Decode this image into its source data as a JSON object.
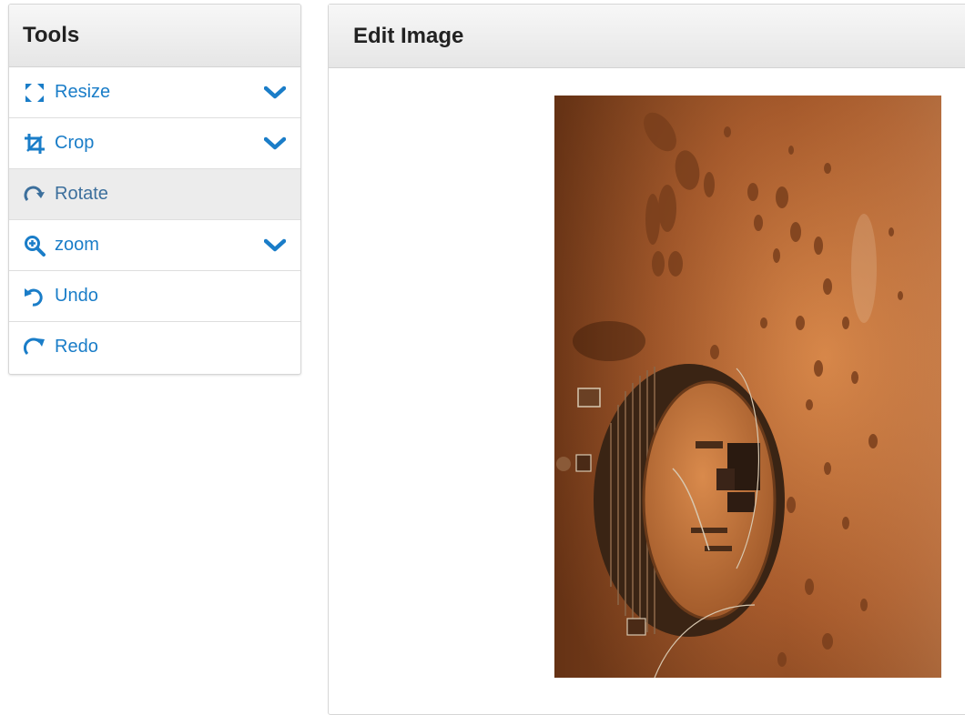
{
  "tools": {
    "title": "Tools",
    "items": [
      {
        "label": "Resize",
        "icon": "expand-icon"
      },
      {
        "label": "Crop",
        "icon": "crop-icon"
      },
      {
        "label": "Rotate",
        "icon": "rotate-icon"
      },
      {
        "label": "zoom",
        "icon": "zoom-in-icon"
      },
      {
        "label": "Undo",
        "icon": "undo-icon"
      },
      {
        "label": "Redo",
        "icon": "redo-icon"
      }
    ]
  },
  "editor": {
    "title": "Edit Image"
  },
  "colors": {
    "accent": "#1a7dc8",
    "header_bg": "#ececec",
    "active_row": "#ececec"
  }
}
